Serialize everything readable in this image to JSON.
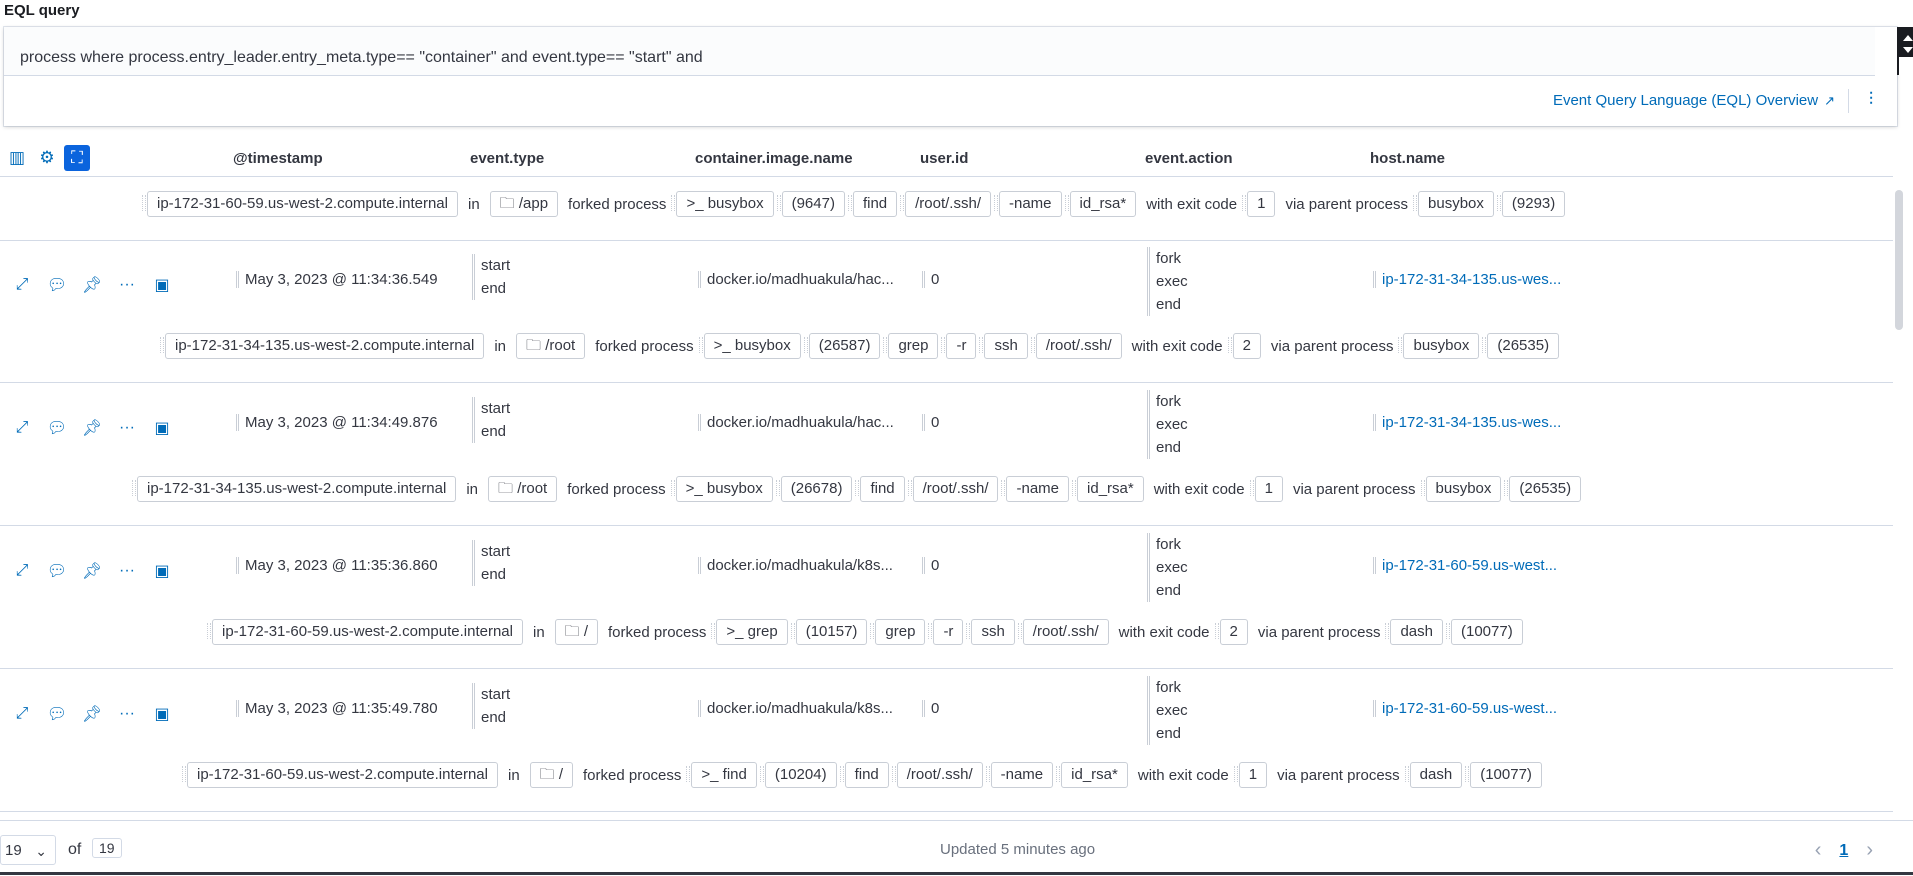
{
  "eql": {
    "label": "EQL query",
    "query": "process where process.entry_leader.entry_meta.type== \"container\" and event.type== \"start\" and",
    "overview_link": "Event Query Language (EQL) Overview"
  },
  "header": {
    "columns": [
      "@timestamp",
      "event.type",
      "container.image.name",
      "user.id",
      "event.action",
      "host.name"
    ]
  },
  "top_renderer": [
    "ip-172-31-60-59.us-west-2.compute.internal",
    "in",
    "/app",
    "forked process",
    ">_ busybox",
    "(9647)",
    "find",
    "/root/.ssh/",
    "-name",
    "id_rsa*",
    "with exit code",
    "1",
    "via parent process",
    "busybox",
    "(9293)"
  ],
  "rows": [
    {
      "timestamp": "May 3, 2023 @ 11:34:36.549",
      "event_type": [
        "start",
        "end"
      ],
      "image": "docker.io/madhuakula/hac...",
      "user_id": "0",
      "event_action": [
        "fork",
        "exec",
        "end"
      ],
      "host": "ip-172-31-34-135.us-wes...",
      "renderer": {
        "host": "ip-172-31-34-135.us-west-2.compute.internal",
        "in": "in",
        "dir": "/root",
        "forked": "forked process",
        "process": ">_ busybox",
        "pid": "(26587)",
        "args": [
          "grep",
          "-r",
          "ssh",
          "/root/.ssh/"
        ],
        "exit_text": "with exit code",
        "exit_code": "2",
        "via": "via parent process",
        "parent": "busybox",
        "ppid": "(26535)"
      }
    },
    {
      "timestamp": "May 3, 2023 @ 11:34:49.876",
      "event_type": [
        "start",
        "end"
      ],
      "image": "docker.io/madhuakula/hac...",
      "user_id": "0",
      "event_action": [
        "fork",
        "exec",
        "end"
      ],
      "host": "ip-172-31-34-135.us-wes...",
      "renderer": {
        "host": "ip-172-31-34-135.us-west-2.compute.internal",
        "in": "in",
        "dir": "/root",
        "forked": "forked process",
        "process": ">_ busybox",
        "pid": "(26678)",
        "args": [
          "find",
          "/root/.ssh/",
          "-name",
          "id_rsa*"
        ],
        "exit_text": "with exit code",
        "exit_code": "1",
        "via": "via parent process",
        "parent": "busybox",
        "ppid": "(26535)"
      }
    },
    {
      "timestamp": "May 3, 2023 @ 11:35:36.860",
      "event_type": [
        "start",
        "end"
      ],
      "image": "docker.io/madhuakula/k8s...",
      "user_id": "0",
      "event_action": [
        "fork",
        "exec",
        "end"
      ],
      "host": "ip-172-31-60-59.us-west...",
      "renderer": {
        "host": "ip-172-31-60-59.us-west-2.compute.internal",
        "in": "in",
        "dir": "/",
        "forked": "forked process",
        "process": ">_ grep",
        "pid": "(10157)",
        "args": [
          "grep",
          "-r",
          "ssh",
          "/root/.ssh/"
        ],
        "exit_text": "with exit code",
        "exit_code": "2",
        "via": "via parent process",
        "parent": "dash",
        "ppid": "(10077)"
      }
    },
    {
      "timestamp": "May 3, 2023 @ 11:35:49.780",
      "event_type": [
        "start",
        "end"
      ],
      "image": "docker.io/madhuakula/k8s...",
      "user_id": "0",
      "event_action": [
        "fork",
        "exec",
        "end"
      ],
      "host": "ip-172-31-60-59.us-west...",
      "renderer": {
        "host": "ip-172-31-60-59.us-west-2.compute.internal",
        "in": "in",
        "dir": "/",
        "forked": "forked process",
        "process": ">_ find",
        "pid": "(10204)",
        "args": [
          "find",
          "/root/.ssh/",
          "-name",
          "id_rsa*"
        ],
        "exit_text": "with exit code",
        "exit_code": "1",
        "via": "via parent process",
        "parent": "dash",
        "ppid": "(10077)"
      }
    }
  ],
  "footer": {
    "page_size": "19",
    "of_label": "of",
    "total": "19",
    "updated": "Updated 5 minutes ago",
    "current_page": "1"
  }
}
